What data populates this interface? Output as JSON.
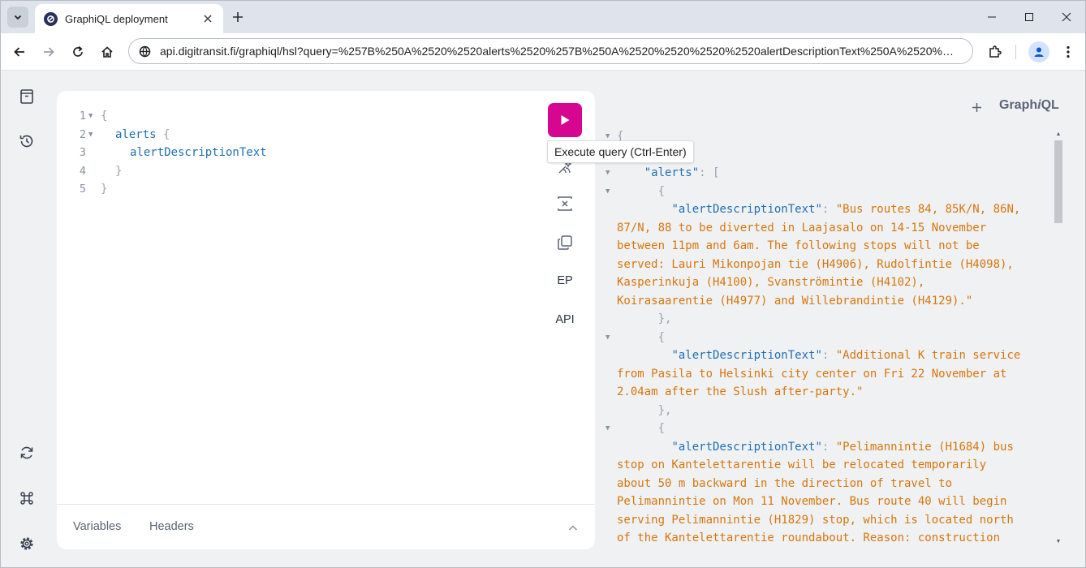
{
  "browser": {
    "tab_title": "GraphiQL deployment",
    "url": "api.digitransit.fi/graphiql/hsl?query=%257B%250A%2520%2520alerts%2520%257B%250A%2520%2520%2520%2520alertDescriptionText%250A%2520%2520..."
  },
  "editor": {
    "lines": [
      {
        "num": "1",
        "fold": true,
        "text": "{"
      },
      {
        "num": "2",
        "fold": true,
        "field": "alerts",
        "brace": "{"
      },
      {
        "num": "3",
        "fold": false,
        "field": "alertDescriptionText"
      },
      {
        "num": "4",
        "fold": false,
        "text": "}"
      },
      {
        "num": "5",
        "fold": false,
        "text": "}"
      }
    ],
    "execute_tooltip": "Execute query (Ctrl-Enter)",
    "tools": {
      "ep_label": "EP",
      "api_label": "API"
    },
    "footer": {
      "variables_label": "Variables",
      "headers_label": "Headers"
    }
  },
  "header": {
    "logo_prefix": "Graph",
    "logo_i": "i",
    "logo_suffix": "QL"
  },
  "result": {
    "lines": [
      {
        "fold": true,
        "text": "{",
        "cls": "rpunct"
      },
      {
        "fold": false,
        "text": ""
      },
      {
        "fold": true,
        "indent": "    ",
        "key": "\"alerts\"",
        "rest": ": ["
      },
      {
        "fold": true,
        "indent": "      ",
        "text": "{",
        "cls": "rpunct"
      },
      {
        "fold": false,
        "indent": "        ",
        "key": "\"alertDescriptionText\"",
        "rest": ": ",
        "str": "\"Bus routes 84, 85K/N, 86N,"
      },
      {
        "fold": false,
        "strline": "87/N, 88 to be diverted in Laajasalo on 14-15 November"
      },
      {
        "fold": false,
        "strline": "between 11pm and 6am. The following stops will not be"
      },
      {
        "fold": false,
        "strline": "served: Lauri Mikonpojan tie (H4906), Rudolfintie (H4098),"
      },
      {
        "fold": false,
        "strline": "Kasperinkuja (H4100), Svanströmintie (H4102),"
      },
      {
        "fold": false,
        "strline": "Koirasaarentie (H4977) and Willebrandintie (H4129).\""
      },
      {
        "fold": false,
        "indent": "      ",
        "text": "},",
        "cls": "rpunct"
      },
      {
        "fold": true,
        "indent": "      ",
        "text": "{",
        "cls": "rpunct"
      },
      {
        "fold": false,
        "indent": "        ",
        "key": "\"alertDescriptionText\"",
        "rest": ": ",
        "str": "\"Additional K train service"
      },
      {
        "fold": false,
        "strline": "from Pasila to Helsinki city center on Fri 22 November at"
      },
      {
        "fold": false,
        "strline": "2.04am after the Slush after-party.\""
      },
      {
        "fold": false,
        "indent": "      ",
        "text": "},",
        "cls": "rpunct"
      },
      {
        "fold": true,
        "indent": "      ",
        "text": "{",
        "cls": "rpunct"
      },
      {
        "fold": false,
        "indent": "        ",
        "key": "\"alertDescriptionText\"",
        "rest": ": ",
        "str": "\"Pelimannintie (H1684) bus"
      },
      {
        "fold": false,
        "strline": "stop on Kantelettarentie will be relocated temporarily"
      },
      {
        "fold": false,
        "strline": "about 50 m backward in the direction of travel to"
      },
      {
        "fold": false,
        "strline": "Pelimannintie on Mon 11 November. Bus route 40 will begin"
      },
      {
        "fold": false,
        "strline": "serving Pelimannintie (H1829) stop, which is located north"
      },
      {
        "fold": false,
        "strline": "of the Kantelettarentie roundabout. Reason: construction"
      }
    ]
  },
  "colors": {
    "accent": "#d60690",
    "field": "#1f6fb2",
    "string": "#d6770d"
  }
}
